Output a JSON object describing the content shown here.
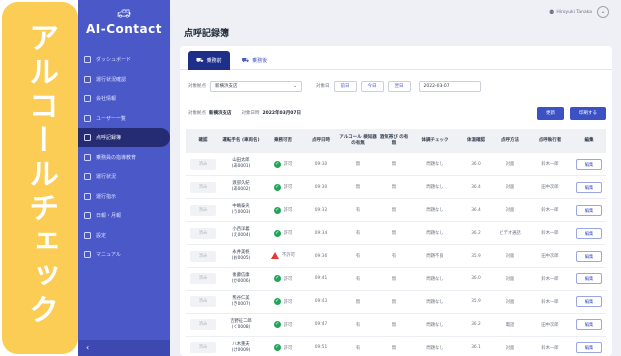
{
  "banner": {
    "text": "アルコールチェック",
    "color": "#fbcd55"
  },
  "app": {
    "name": "AI-Contact",
    "logo_icon": "car-icon"
  },
  "sidebar": {
    "items": [
      {
        "label": "ダッシュボード",
        "icon": "dashboard-icon",
        "active": false
      },
      {
        "label": "運行状況確認",
        "icon": "status-icon",
        "active": false
      },
      {
        "label": "会社情報",
        "icon": "building-icon",
        "active": false
      },
      {
        "label": "ユーザー一覧",
        "icon": "user-icon",
        "active": false
      },
      {
        "label": "点呼記録簿",
        "icon": "clipboard-icon",
        "active": true
      },
      {
        "label": "乗務員の指導教育",
        "icon": "education-icon",
        "active": false
      },
      {
        "label": "運行状況",
        "icon": "route-icon",
        "active": false
      },
      {
        "label": "運行指示",
        "icon": "instruction-icon",
        "active": false
      },
      {
        "label": "日報・月報",
        "icon": "report-icon",
        "active": false
      },
      {
        "label": "設定",
        "icon": "gear-icon",
        "active": false
      },
      {
        "label": "マニュアル",
        "icon": "manual-icon",
        "active": false
      }
    ],
    "collapse_label": "‹",
    "color": "#4a58c8"
  },
  "header": {
    "user_name": "Hiroyuki Tanaka",
    "chevron": "⌄"
  },
  "page": {
    "title": "点呼記録簿",
    "tabs": [
      {
        "label": "乗務前",
        "icon": "truck-icon",
        "active": true
      },
      {
        "label": "乗務後",
        "icon": "truck-icon",
        "active": false
      }
    ],
    "filters": {
      "office_label": "対象拠点",
      "office_value": "新横浜支店",
      "date_label": "対象日",
      "buttons": [
        "前日",
        "今日",
        "翌日"
      ],
      "date_value": "2022-03-07"
    },
    "info": {
      "office_label": "対象拠点",
      "office_value": "新横浜支店",
      "date_label": "対象日時",
      "date_value": "2022年03月07日"
    },
    "actions": {
      "update": "更新",
      "print": "印刷する"
    }
  },
  "table": {
    "headers": [
      "確認",
      "運転手名 (車両名)",
      "乗務可否",
      "点呼日時",
      "アルコール 検知器の有無",
      "酒気帯び の有無",
      "体調チェック",
      "体温確認",
      "点呼方法",
      "点呼執行者",
      "編集"
    ],
    "confirm_label": "済み",
    "edit_label": "編集",
    "rows": [
      {
        "name": "山田太郎",
        "vehicle": "(あ0001)",
        "status": "許可",
        "ok": true,
        "time": "09:30",
        "detector": "無",
        "alcohol": "無",
        "health": "問題なし",
        "temp": "36.0",
        "method": "対面",
        "executor": "鈴木一郎"
      },
      {
        "name": "渡部久紀",
        "vehicle": "(あ0002)",
        "status": "許可",
        "ok": true,
        "time": "09:30",
        "detector": "無",
        "alcohol": "無",
        "health": "問題なし",
        "temp": "36.4",
        "method": "対面",
        "executor": "田中次郎"
      },
      {
        "name": "中嶋泰央",
        "vehicle": "(う0003)",
        "status": "許可",
        "ok": true,
        "time": "09:32",
        "detector": "有",
        "alcohol": "無",
        "health": "問題なし",
        "temp": "36.4",
        "method": "対面",
        "executor": "鈴木一郎"
      },
      {
        "name": "小西洋義",
        "vehicle": "(え0004)",
        "status": "許可",
        "ok": true,
        "time": "09:34",
        "detector": "有",
        "alcohol": "無",
        "health": "問題なし",
        "temp": "36.2",
        "method": "ビデオ通話",
        "executor": "鈴木一郎"
      },
      {
        "name": "永井美帆",
        "vehicle": "(お0005)",
        "status": "不許可",
        "ok": false,
        "time": "09:36",
        "detector": "有",
        "alcohol": "有",
        "health": "問題不良",
        "temp": "35.9",
        "method": "対面",
        "executor": "田中次郎"
      },
      {
        "name": "後藤信康",
        "vehicle": "(か0006)",
        "status": "許可",
        "ok": true,
        "time": "09:41",
        "detector": "有",
        "alcohol": "無",
        "health": "問題なし",
        "temp": "36.0",
        "method": "対面",
        "executor": "鈴木一郎"
      },
      {
        "name": "熊谷仁美",
        "vehicle": "(き0007)",
        "status": "許可",
        "ok": true,
        "time": "09:43",
        "detector": "無",
        "alcohol": "無",
        "health": "問題なし",
        "temp": "35.9",
        "method": "対面",
        "executor": "鈴木一郎"
      },
      {
        "name": "吉野征二郎",
        "vehicle": "(く0008)",
        "status": "許可",
        "ok": true,
        "time": "09:47",
        "detector": "有",
        "alcohol": "無",
        "health": "問題なし",
        "temp": "36.2",
        "method": "電話",
        "executor": "田中次郎"
      },
      {
        "name": "八木重夫",
        "vehicle": "(け0009)",
        "status": "許可",
        "ok": true,
        "time": "09:51",
        "detector": "有",
        "alcohol": "無",
        "health": "問題なし",
        "temp": "36.1",
        "method": "対面",
        "executor": "鈴木一郎"
      }
    ]
  }
}
